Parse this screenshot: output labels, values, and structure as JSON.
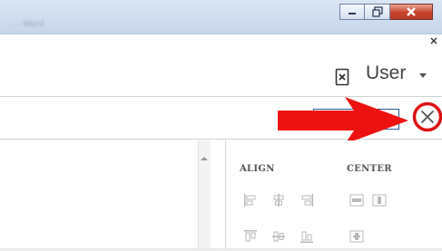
{
  "window": {
    "title": "... - Word",
    "controls": [
      "minimize-icon",
      "maximize-icon",
      "close-icon"
    ]
  },
  "ribbon": {
    "user_label": "User",
    "user_icon": "presence-icon",
    "caret_icon": "chevron-down-icon"
  },
  "search": {
    "value": "",
    "placeholder": "",
    "close_icon": "close-circle-icon"
  },
  "annotation": {
    "arrow_color": "#ee1111",
    "highlight_color": "#dd1111"
  },
  "panel": {
    "align_heading": "ALIGN",
    "center_heading": "CENTER",
    "align_tools": [
      "align-left-icon",
      "align-center-icon",
      "align-right-icon",
      "align-top-icon",
      "align-middle-icon",
      "align-bottom-icon"
    ],
    "center_tools": [
      "center-horizontal-icon",
      "center-page-icon",
      "center-vertical-icon"
    ]
  },
  "colors": {
    "accent": "#2b579a",
    "tool_icon": "#b8b8b8"
  }
}
